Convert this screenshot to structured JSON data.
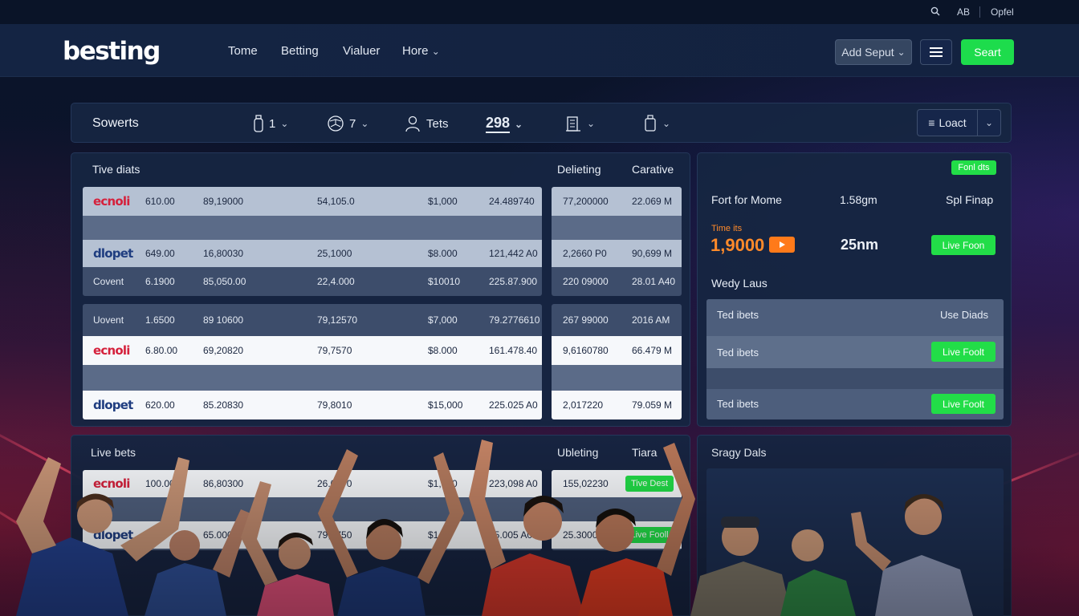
{
  "util": {
    "search": "Q",
    "ab": "AB",
    "options": "Opfel"
  },
  "nav": {
    "logo": "besting",
    "links": [
      "Tome",
      "Betting",
      "Vialuer",
      "Hore"
    ],
    "add_button": "Add Seput",
    "cta_button": "Seart"
  },
  "filter": {
    "title": "Sowerts",
    "items": [
      {
        "icon": "bottle-icon",
        "label": "1"
      },
      {
        "icon": "ball-icon",
        "label": "7"
      },
      {
        "icon": "user-icon",
        "label": "Tets"
      },
      {
        "icon": "",
        "label": "298"
      },
      {
        "icon": "building-icon",
        "label": ""
      },
      {
        "icon": "tag-icon",
        "label": ""
      }
    ],
    "load_button": "Loact"
  },
  "tive": {
    "title": "Tive diats",
    "col_a": "Delieting",
    "col_b": "Carative",
    "rows": [
      {
        "style": "light",
        "brand": "ecnoli",
        "c": [
          "610.00",
          "89,19000",
          "54,105.0",
          "$1,000",
          "24.489740"
        ],
        "r": [
          "77,200000",
          "22.069 M"
        ]
      },
      {
        "style": "mid",
        "brand": "",
        "c": [
          "",
          "",
          "",
          "",
          ""
        ],
        "r": [
          "",
          ""
        ]
      },
      {
        "style": "light",
        "brand": "dlopet",
        "c": [
          "649.00",
          "16,80030",
          "25,1000",
          "$8.000",
          "121,442 A0"
        ],
        "r": [
          "2,2660 P0",
          "90,699 M"
        ]
      },
      {
        "style": "dark",
        "brand": "Covent",
        "c": [
          "6.1900",
          "85,050.00",
          "22,4.000",
          "$10010",
          "225.87.900"
        ],
        "r": [
          "220 09000",
          "28.01 A40"
        ]
      },
      {
        "style": "dark",
        "brand": "Uovent",
        "c": [
          "1.6500",
          "89 10600",
          "79,12570",
          "$7,000",
          "79.2776610"
        ],
        "r": [
          "267 99000",
          "2016 AM"
        ]
      },
      {
        "style": "white",
        "brand": "ecnoli",
        "c": [
          "6.80.00",
          "69,20820",
          "79,7570",
          "$8.000",
          "161.478.40"
        ],
        "r": [
          "9,6160780",
          "66.479 M"
        ]
      },
      {
        "style": "mid",
        "brand": "",
        "c": [
          "",
          "",
          "",
          "",
          ""
        ],
        "r": [
          "",
          ""
        ]
      },
      {
        "style": "white",
        "brand": "dlopet",
        "c": [
          "620.00",
          "85.20830",
          "79,8010",
          "$15,000",
          "225.025 A0"
        ],
        "r": [
          "2,017220",
          "79.059 M"
        ]
      }
    ]
  },
  "side": {
    "badge": "Fonl dts",
    "info_label": "Fort for Mome",
    "info_time": "1.58gm",
    "info_right": "Spl Finap",
    "time_label": "Time its",
    "big_value": "1,9000",
    "duration": "25nm",
    "live_button": "Live Foon",
    "weekly_title": "Wedy Laus",
    "table_header_left": "Ted ibets",
    "table_header_right": "Use Diads",
    "rows": [
      {
        "label": "Ted ibets",
        "button": "Live Foolt"
      },
      {
        "label": "Ted ibets",
        "button": "Live Foolt"
      }
    ]
  },
  "live": {
    "title": "Live bets",
    "col_a": "Ubleting",
    "col_b": "Tiara",
    "rows": [
      {
        "style": "white",
        "brand": "ecnoli",
        "c": [
          "100.00",
          "86,80300",
          "26.0170",
          "$1,000",
          "223,098 A0"
        ],
        "r": [
          "155,02230"
        ],
        "button": "Tive Dest"
      },
      {
        "style": "white",
        "brand": "dlopet",
        "c": [
          "",
          "65.0000",
          "79,7750",
          "$1",
          "15.005 A0"
        ],
        "r": [
          "25.30000"
        ],
        "button": "Live Fooll"
      }
    ]
  },
  "deals": {
    "title": "Sragy Dals"
  },
  "colors": {
    "accent_green": "#1ddc4c",
    "brand_red": "#d5213c",
    "brand_blue": "#1f3d80",
    "orange": "#ff7a1a"
  }
}
